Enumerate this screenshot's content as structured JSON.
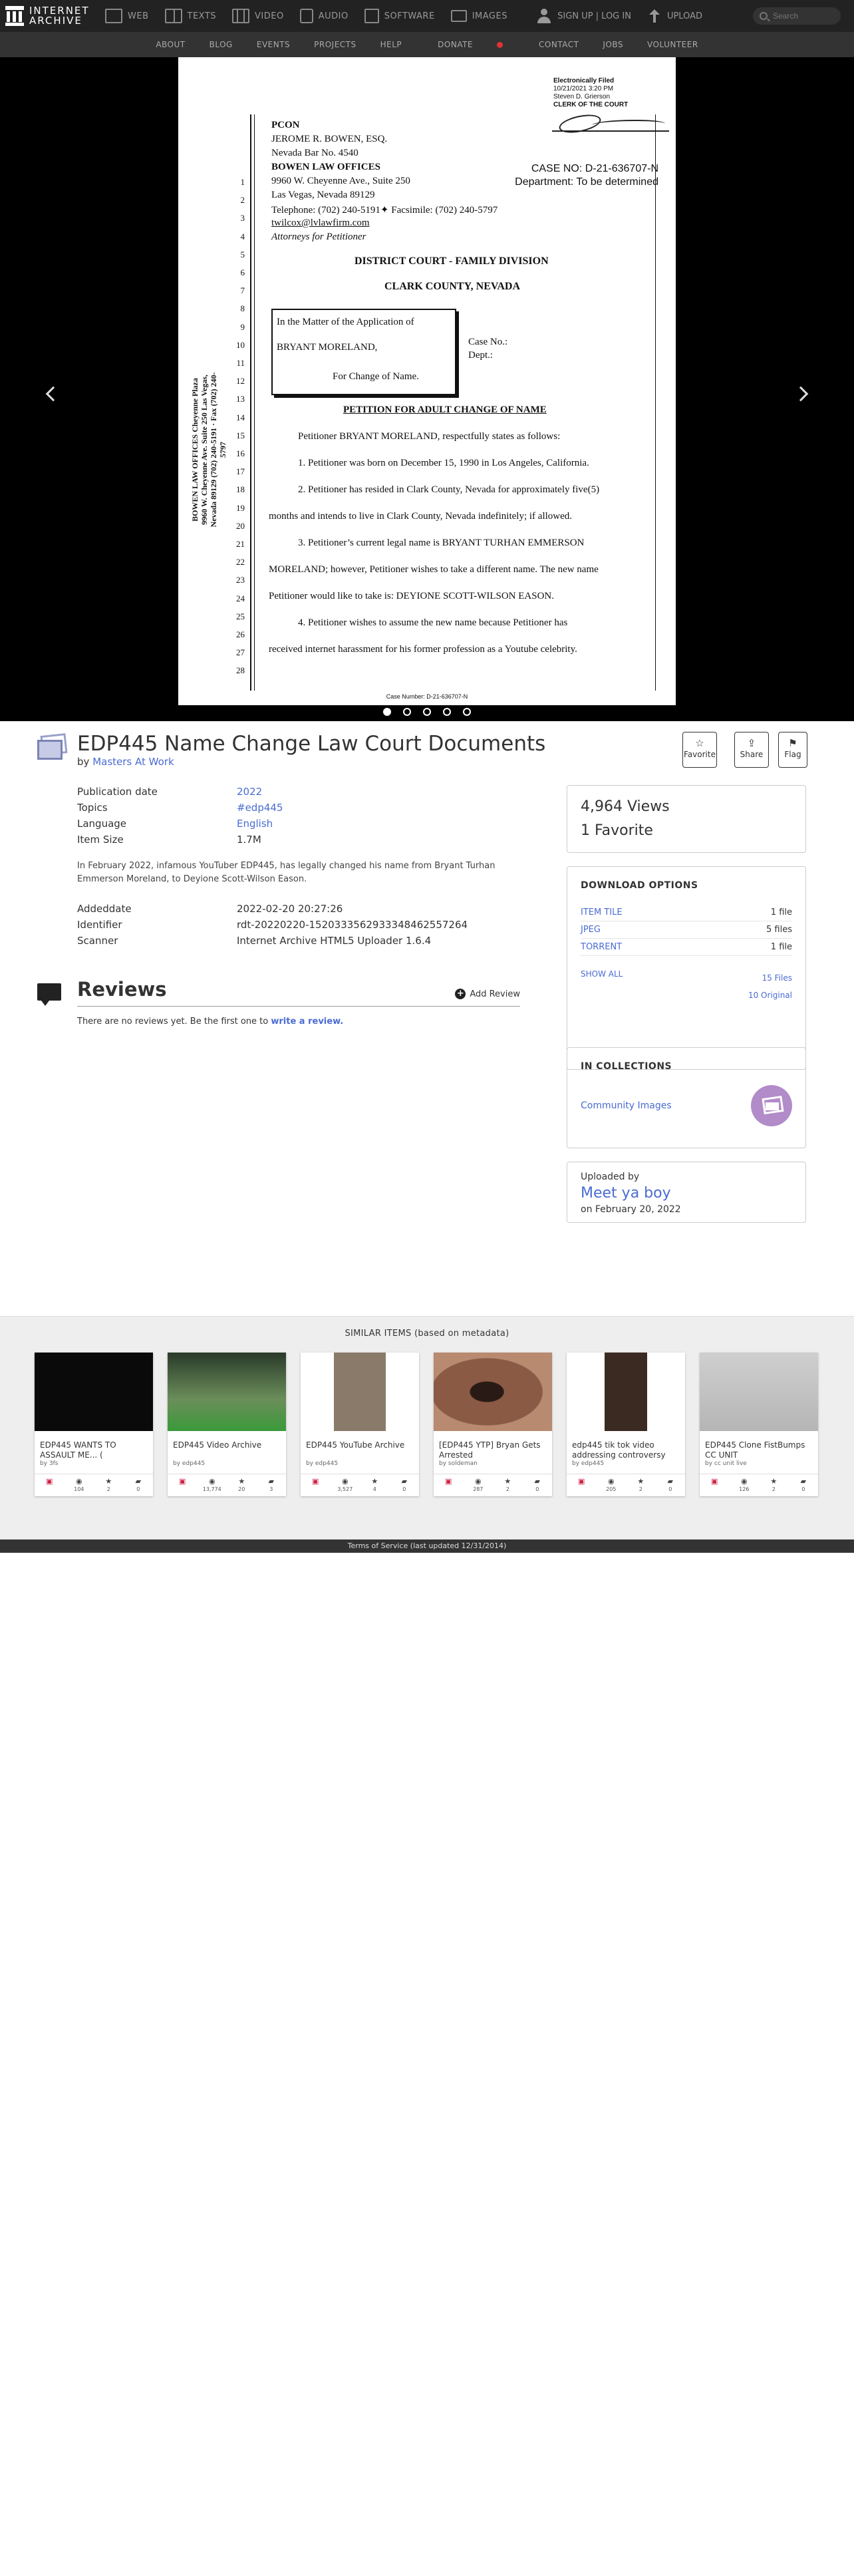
{
  "nav": {
    "logo_line1": "INTERNET",
    "logo_line2": "ARCHIVE",
    "items": [
      "WEB",
      "TEXTS",
      "VIDEO",
      "AUDIO",
      "SOFTWARE",
      "IMAGES"
    ],
    "signin": "SIGN UP | LOG IN",
    "upload": "UPLOAD",
    "search_placeholder": "Search"
  },
  "subnav": [
    "ABOUT",
    "BLOG",
    "EVENTS",
    "PROJECTS",
    "HELP",
    "DONATE",
    "CONTACT",
    "JOBS",
    "VOLUNTEER"
  ],
  "document": {
    "stamp": [
      "Electronically Filed",
      "10/21/2021 3:20 PM",
      "Steven D. Grierson",
      "CLERK OF THE COURT"
    ],
    "line_numbers": [
      "1",
      "2",
      "3",
      "4",
      "5",
      "6",
      "7",
      "8",
      "9",
      "10",
      "11",
      "12",
      "13",
      "14",
      "15",
      "16",
      "17",
      "18",
      "19",
      "20",
      "21",
      "22",
      "23",
      "24",
      "25",
      "26",
      "27",
      "28"
    ],
    "pcon": "PCON",
    "attorney": "JEROME R. BOWEN, ESQ.",
    "bar": "Nevada Bar No. 4540",
    "firm": "BOWEN LAW OFFICES",
    "address1": "9960 W. Cheyenne Ave., Suite 250",
    "address2": "Las Vegas, Nevada 89129",
    "phone": "Telephone: (702) 240-5191✦ Facsimile: (702) 240-5797",
    "email": "twilcox@lvlawfirm.com",
    "attorneys_for": "Attorneys for Petitioner",
    "case_no": "CASE NO: D-21-636707-N",
    "department": "Department: To be determined",
    "court": "DISTRICT COURT - FAMILY DIVISION",
    "county": "CLARK COUNTY, NEVADA",
    "matter": "In the Matter of the Application of",
    "party": "BRYANT MORELAND,",
    "for_change": "For Change of Name.",
    "case_label": "Case No.:",
    "dept_label": "Dept.:",
    "petition_title": "PETITION FOR ADULT CHANGE OF NAME",
    "intro": "Petitioner BRYANT MORELAND, respectfully states as follows:",
    "p1": "1.        Petitioner was born on December 15, 1990 in Los Angeles, California.",
    "p2a": "2.        Petitioner has resided in Clark County, Nevada for approximately five(5)",
    "p2b": "months and intends to live in Clark County, Nevada indefinitely; if allowed.",
    "p3a": "3.        Petitioner’s current legal name is BRYANT TURHAN EMMERSON",
    "p3b": "MORELAND; however, Petitioner wishes to take a different name.  The new name",
    "p3c": "Petitioner would like to take is: DEYIONE SCOTT-WILSON EASON.",
    "p4a": "4.        Petitioner wishes to assume the new name because Petitioner has",
    "p4b": "received internet harassment for his former profession as a Youtube celebrity.",
    "sidebar": "BOWEN LAW OFFICES Cheyenne Plaza 9960 W. Cheyenne Ave. Suite 250 Las Vegas, Nevada 89129 (702) 240-5191 · Fax (702) 240-5797",
    "footer": "Case Number: D-21-636707-N"
  },
  "item": {
    "title": "EDP445 Name Change Law Court Documents",
    "by_label": "by",
    "author": "Masters At Work",
    "favorite": "Favorite",
    "share": "Share",
    "flag": "Flag",
    "metadata": [
      {
        "label": "Publication date",
        "value": "2022",
        "link": true
      },
      {
        "label": "Topics",
        "value": "#edp445",
        "link": true
      },
      {
        "label": "Language",
        "value": "English",
        "link": true
      },
      {
        "label": "Item Size",
        "value": "1.7M",
        "link": false
      }
    ],
    "description": "In February 2022, infamous YouTuber EDP445, has legally changed his name from Bryant Turhan Emmerson Moreland, to Deyione Scott-Wilson Eason.",
    "metadata2": [
      {
        "label": "Addeddate",
        "value": "2022-02-20 20:27:26"
      },
      {
        "label": "Identifier",
        "value": "rdt-20220220-152033356293334846255726​4"
      },
      {
        "label": "Scanner",
        "value": "Internet Archive HTML5 Uploader 1.6.4"
      }
    ]
  },
  "reviews": {
    "title": "Reviews",
    "add": "Add Review",
    "empty_prefix": "There are no reviews yet. Be the first one to",
    "empty_link": "write a review."
  },
  "stats": {
    "views": "4,964 Views",
    "favorites": "1 Favorite"
  },
  "downloads": {
    "heading": "DOWNLOAD OPTIONS",
    "rows": [
      {
        "name": "ITEM TILE",
        "count": "1 file"
      },
      {
        "name": "JPEG",
        "count": "5 files"
      },
      {
        "name": "TORRENT",
        "count": "1 file"
      }
    ],
    "show_all": "SHOW ALL",
    "files": "15 Files",
    "original": "10 Original"
  },
  "collections": {
    "heading": "IN COLLECTIONS",
    "name": "Community Images"
  },
  "uploader": {
    "label": "Uploaded by",
    "name": "Meet ya boy",
    "date": "on February 20, 2022"
  },
  "similar": {
    "heading": "SIMILAR ITEMS (based on metadata)",
    "items": [
      {
        "title": "EDP445 WANTS TO ASSAULT ME... (",
        "by": "by 3fs",
        "views": "104",
        "favs": "2",
        "reviews": "0"
      },
      {
        "title": "EDP445 Video Archive",
        "by": "by edp445",
        "views": "13,774",
        "favs": "20",
        "reviews": "3"
      },
      {
        "title": "EDP445 YouTube Archive",
        "by": "by edp445",
        "views": "3,527",
        "favs": "4",
        "reviews": "0"
      },
      {
        "title": "[EDP445 YTP] Bryan Gets Arrested",
        "by": "by soldeman",
        "views": "287",
        "favs": "2",
        "reviews": "0"
      },
      {
        "title": "edp445 tik tok video addressing controversy",
        "by": "by edp445",
        "views": "205",
        "favs": "2",
        "reviews": "0"
      },
      {
        "title": "EDP445 Clone FistBumps CC UNIT",
        "by": "by cc unit live",
        "views": "126",
        "favs": "2",
        "reviews": "0"
      }
    ]
  },
  "footer": "Terms of Service (last updated 12/31/2014)",
  "colors": {
    "link": "#4a6bd3",
    "nav_bg": "#222222",
    "subnav_bg": "#333333",
    "donate_heart": "#e03333",
    "collection_badge": "#b28bc9"
  }
}
